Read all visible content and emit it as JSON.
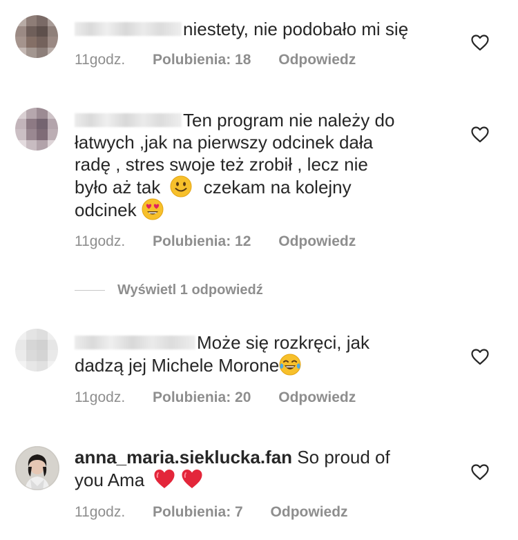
{
  "comments": [
    {
      "text": "niestety, nie podobało mi  się",
      "time": "11godz.",
      "likes": "Polubienia: 18",
      "reply": "Odpowiedz"
    },
    {
      "text_lines": [
        "Ten program nie należy do",
        "łatwych ,jak na pierwszy odcinek dała",
        "radę , stres swoje też zrobił , lecz nie",
        "było aż tak",
        "czekam na kolejny",
        "odcinek"
      ],
      "time": "11godz.",
      "likes": "Polubienia: 12",
      "reply": "Odpowiedz",
      "view_replies": "Wyświetl 1 odpowiedź"
    },
    {
      "text_lines": [
        "Może się rozkręci, jak",
        "dadzą jej Michele Morone"
      ],
      "time": "11godz.",
      "likes": "Polubienia: 20",
      "reply": "Odpowiedz"
    },
    {
      "username": "anna_maria.sieklucka.fan",
      "text_lines": [
        "So proud of",
        "you Ama"
      ],
      "time": "11godz.",
      "likes": "Polubienia: 7",
      "reply": "Odpowiedz"
    }
  ],
  "icons": {
    "like": "heart-outline-icon",
    "smile": "slightly-smiling-face-emoji",
    "heart_eyes": "heart-eyes-emoji",
    "laughing": "tears-of-joy-emoji",
    "red_heart": "red-heart-emoji"
  },
  "colors": {
    "text": "#262626",
    "meta": "#8e8e8e",
    "heart_red": "#e0245e",
    "emoji_yellow": "#f7c02b"
  }
}
